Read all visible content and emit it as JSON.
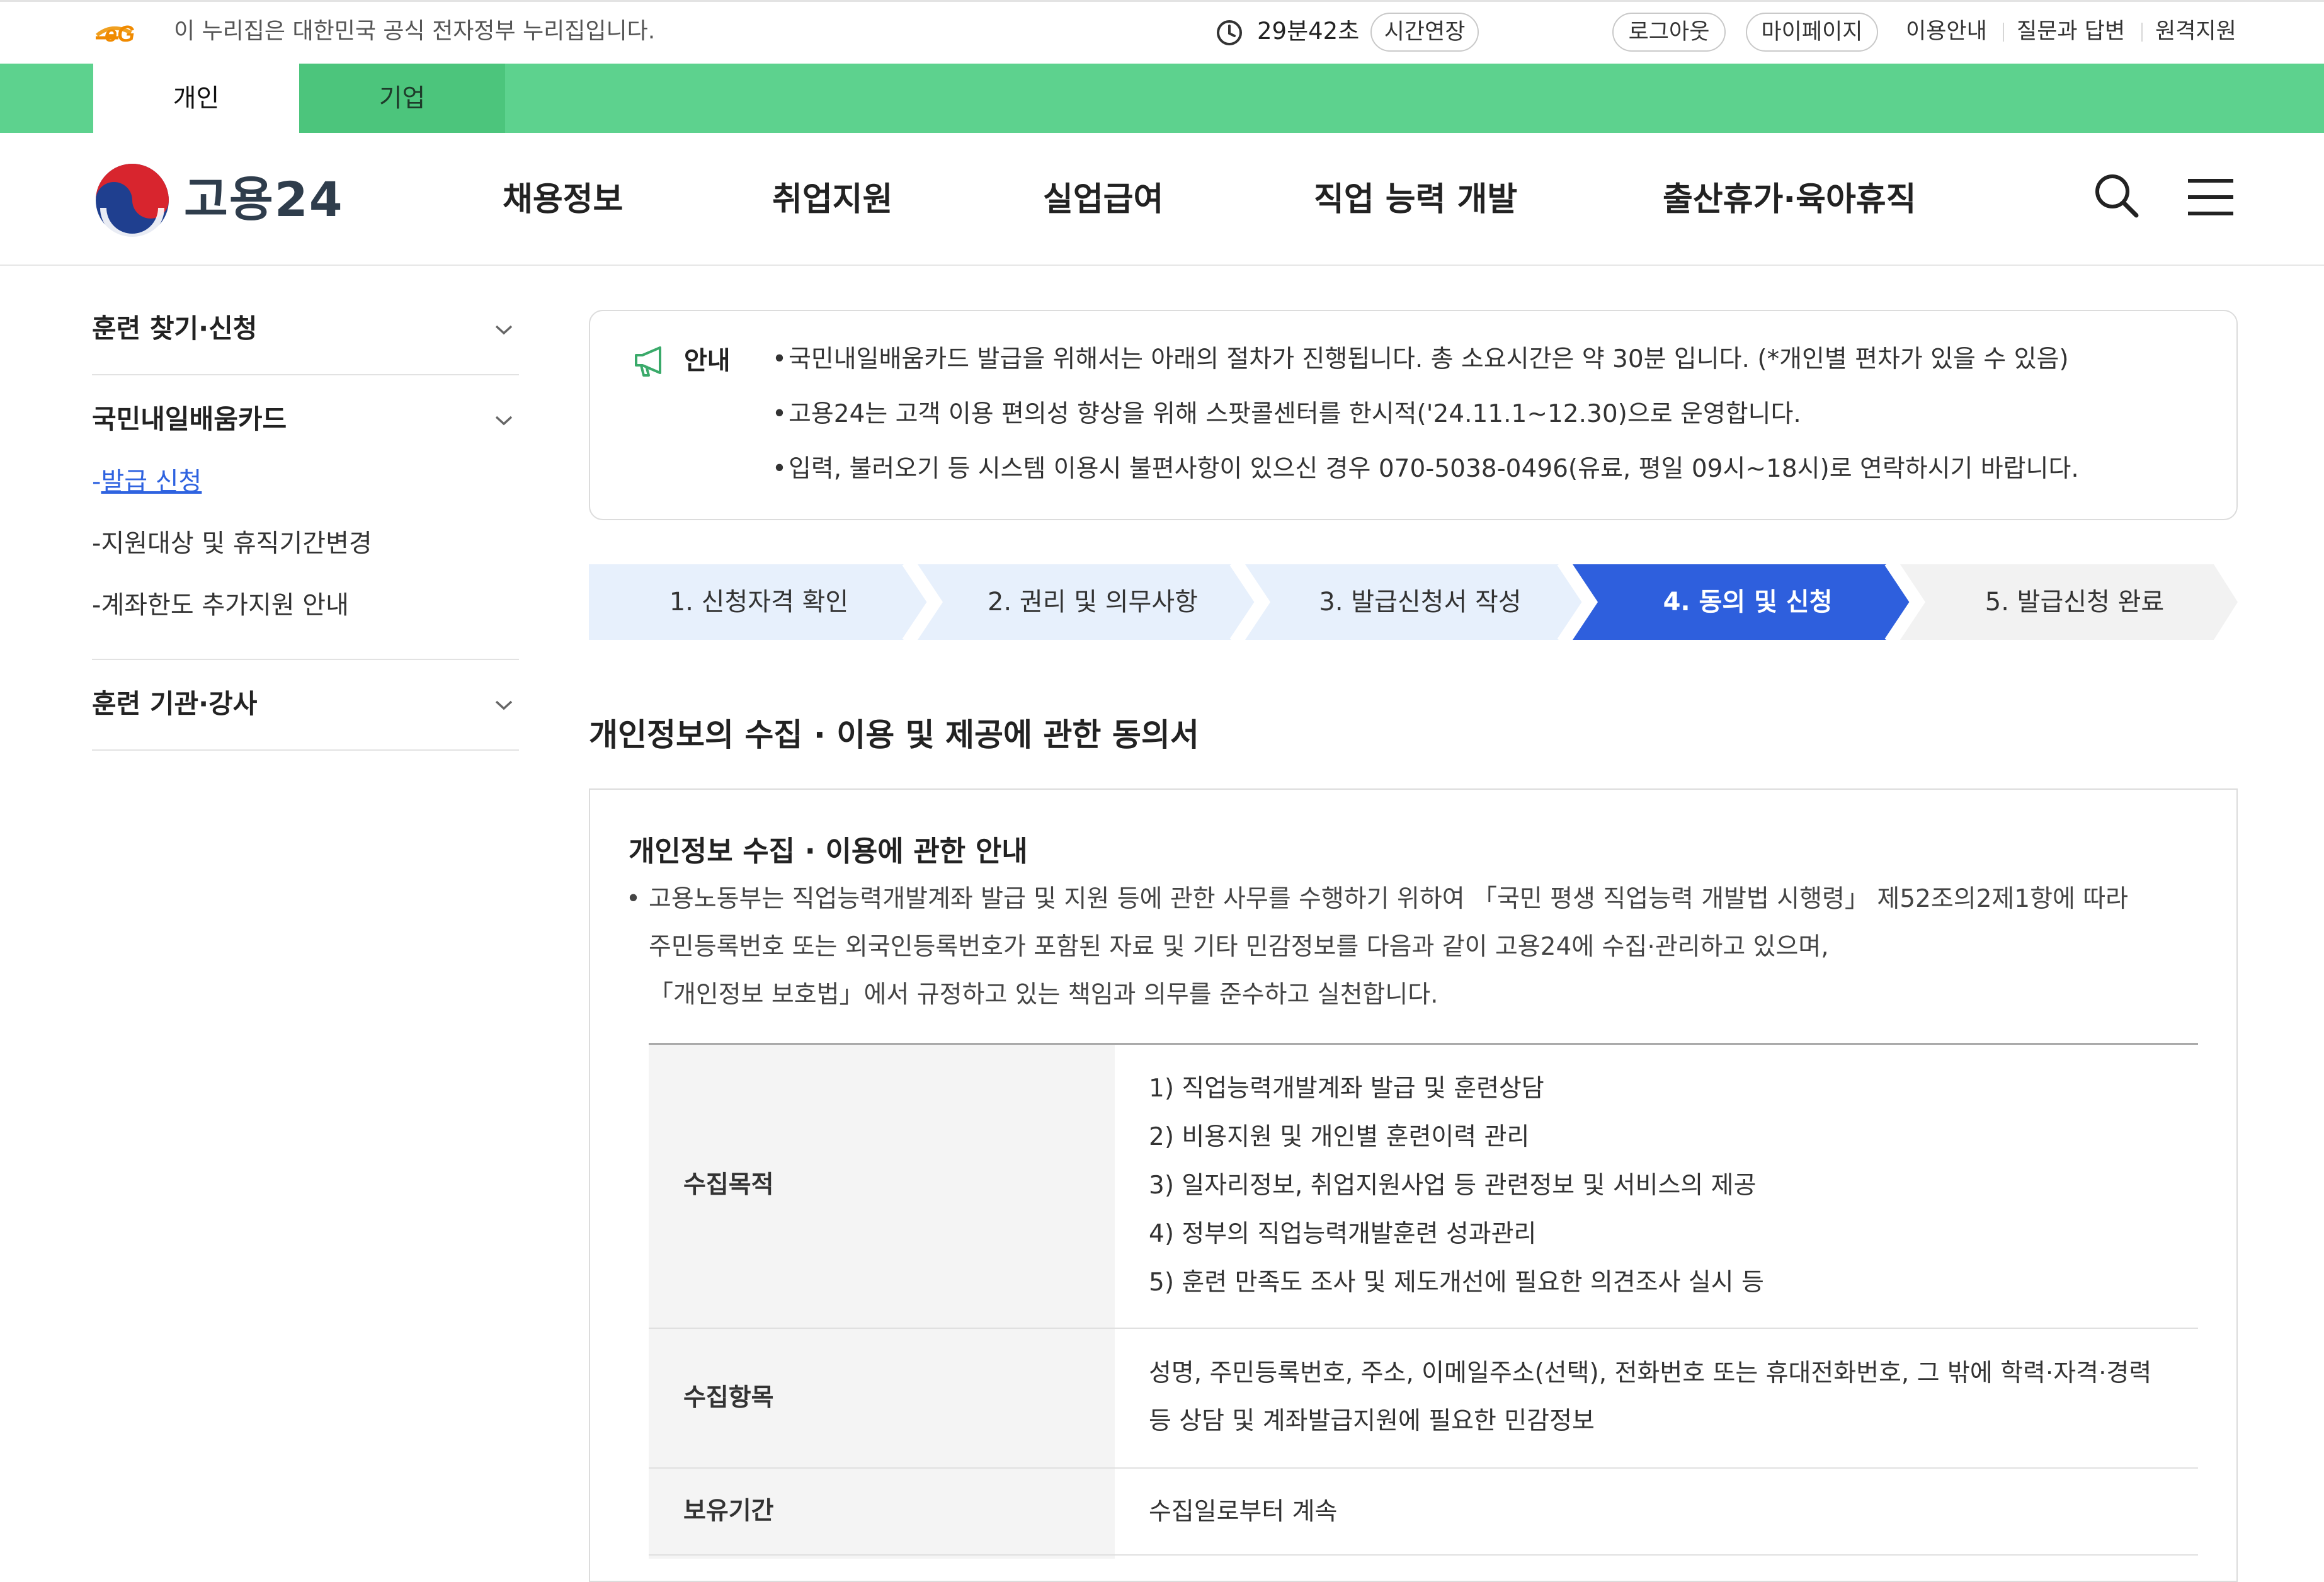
{
  "utility_bar": {
    "gov_notice": "이 누리집은 대한민국 공식 전자정부 누리집입니다.",
    "session_time": "29분42초",
    "extend_label": "시간연장",
    "logout_label": "로그아웃",
    "mypage_label": "마이페이지",
    "links": [
      "이용안내",
      "질문과 답변",
      "원격지원"
    ]
  },
  "user_tabs": {
    "personal": "개인",
    "business": "기업"
  },
  "header": {
    "site_name": "고용24",
    "nav": [
      "채용정보",
      "취업지원",
      "실업급여",
      "직업 능력 개발",
      "출산휴가·육아휴직"
    ],
    "search_icon": "search-icon",
    "menu_icon": "hamburger-menu-icon"
  },
  "sidebar": {
    "sections": [
      {
        "title": "훈련 찾기·신청"
      },
      {
        "title": "국민내일배움카드",
        "items": [
          "발급 신청",
          "지원대상 및 휴직기간변경",
          "계좌한도 추가지원 안내"
        ]
      },
      {
        "title": "훈련 기관·강사"
      }
    ],
    "active_item": "발급 신청"
  },
  "notice": {
    "label": "안내",
    "lines": [
      "국민내일배움카드 발급을 위해서는 아래의 절차가 진행됩니다. 총 소요시간은 약 30분 입니다. (*개인별 편차가 있을 수 있음)",
      "고용24는 고객 이용 편의성 향상을 위해 스팟콜센터를 한시적('24.11.1~12.30)으로 운영합니다.",
      "입력, 불러오기 등 시스템 이용시 불편사항이 있으신 경우 070-5038-0496(유료, 평일 09시~18시)로 연락하시기 바랍니다."
    ]
  },
  "steps": {
    "items": [
      "1. 신청자격 확인",
      "2. 권리 및 의무사항",
      "3. 발급신청서 작성",
      "4. 동의 및 신청",
      "5. 발급신청 완료"
    ],
    "current_index": 3,
    "colors": {
      "done": "#e7f0fc",
      "current": "#2e5fdd",
      "upcoming": "#f2f2f2"
    }
  },
  "consent": {
    "heading": "개인정보의 수집 · 이용 및 제공에 관한 동의서",
    "section_title": "개인정보 수집 · 이용에 관한 안내",
    "intro_lines": [
      "고용노동부는 직업능력개발계좌 발급 및 지원 등에 관한 사무를 수행하기 위하여 「국민 평생 직업능력 개발법 시행령」 제52조의2제1항에 따라",
      "주민등록번호 또는 외국인등록번호가 포함된 자료 및 기타 민감정보를 다음과 같이 고용24에 수집·관리하고 있으며,",
      "「개인정보 보호법」에서 규정하고 있는 책임과 의무를 준수하고 실천합니다."
    ],
    "table": [
      {
        "label": "수집목적",
        "values": [
          "1) 직업능력개발계좌 발급 및 훈련상담",
          "2) 비용지원 및 개인별 훈련이력 관리",
          "3) 일자리정보, 취업지원사업 등 관련정보 및 서비스의 제공",
          "4) 정부의 직업능력개발훈련 성과관리",
          "5) 훈련 만족도 조사 및 제도개선에 필요한 의견조사 실시 등"
        ]
      },
      {
        "label": "수집항목",
        "values": [
          "성명, 주민등록번호, 주소, 이메일주소(선택), 전화번호 또는 휴대전화번호, 그 밖에 학력·자격·경력",
          "등 상담 및 계좌발급지원에 필요한 민감정보"
        ]
      },
      {
        "label": "보유기간",
        "values": [
          "수집일로부터 계속"
        ]
      }
    ]
  },
  "colors": {
    "green": "#5dd28e",
    "accent_blue": "#2e5fdd",
    "link_blue": "#2f63e0"
  }
}
